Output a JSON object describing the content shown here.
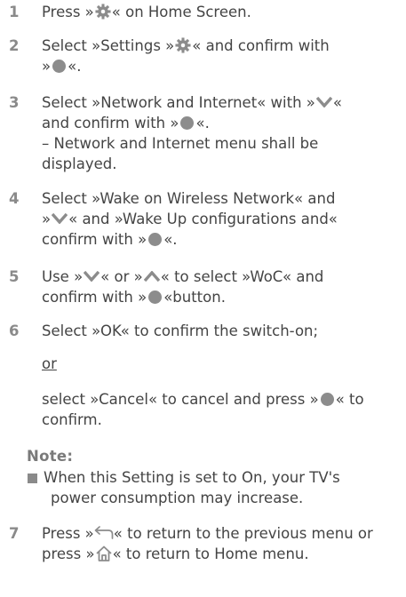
{
  "steps": [
    {
      "number": "1",
      "lines": [
        [
          "Press »",
          "{gear}",
          "« on Home Screen."
        ]
      ]
    },
    {
      "number": "2",
      "lines": [
        [
          "Select »Settings »",
          "{gear}",
          "«  and confirm with"
        ],
        [
          "»",
          "{dot}",
          "«."
        ]
      ]
    },
    {
      "number": "3",
      "lines": [
        [
          "Select »Network and Internet« with »",
          "{down}",
          "«"
        ],
        [
          "and confirm with »",
          "{dot}",
          "«."
        ],
        [
          "– Network and Internet menu shall be"
        ],
        [
          "displayed."
        ]
      ]
    },
    {
      "number": "4",
      "lines": [
        [
          "Select »Wake on Wireless Network« and"
        ],
        [
          "»",
          "{down}",
          "« and »Wake Up configurations and«"
        ],
        [
          "confirm with »",
          "{dot}",
          "«."
        ]
      ]
    },
    {
      "number": "5",
      "lines": [
        [
          "Use »",
          "{down}",
          "« or »",
          "{up}",
          "« to select »WoC« and"
        ],
        [
          "confirm with »",
          "{dot}",
          "«button."
        ]
      ]
    },
    {
      "number": "6",
      "lines": [
        [
          "Select »OK« to confirm the switch-on;"
        ]
      ]
    }
  ],
  "or_text": "or",
  "cancel_lines": [
    [
      "select »Cancel« to cancel and press »",
      "{dot}",
      "« to"
    ],
    [
      "confirm."
    ]
  ],
  "note": {
    "title": "Note:",
    "bullet_lines": [
      "When this Setting is set to On, your TV's",
      "power consumption may increase."
    ]
  },
  "step7": {
    "number": "7",
    "lines": [
      [
        "Press »",
        "{back}",
        "« to return to the previous menu or"
      ],
      [
        "press »",
        "{home}",
        "« to return to Home menu."
      ]
    ]
  },
  "icons": {
    "gear": "gear-icon",
    "dot": "ok-button-icon",
    "down": "chevron-down-icon",
    "up": "chevron-up-icon",
    "back": "back-arrow-icon",
    "home": "home-icon"
  },
  "colors": {
    "text": "#444444",
    "number": "#8a8a8a",
    "icon": "#8c8c8c"
  }
}
